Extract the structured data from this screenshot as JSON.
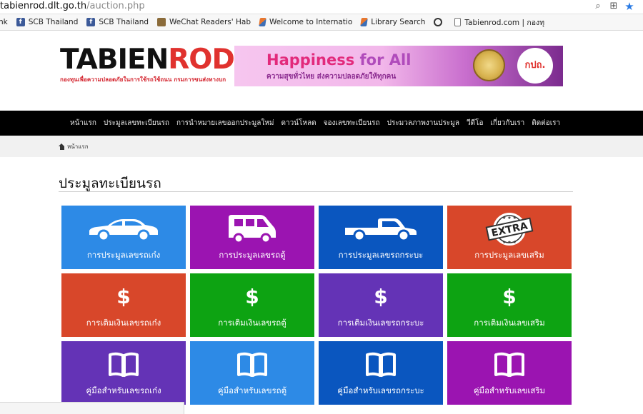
{
  "browser": {
    "url_host": "tabienrod.dlt.go.th",
    "url_path": "/auction.php",
    "bookmarks": [
      {
        "label": "nk",
        "icon": "none"
      },
      {
        "label": "SCB Thailand",
        "icon": "facebook-icon"
      },
      {
        "label": "SCB Thailand",
        "icon": "facebook-icon"
      },
      {
        "label": "WeChat Readers' Hab",
        "icon": "wechat-icon"
      },
      {
        "label": "Welcome to Internatio",
        "icon": "diamond-icon"
      },
      {
        "label": "Library Search",
        "icon": "diamond-icon"
      },
      {
        "label": "",
        "icon": "q-icon"
      },
      {
        "label": "Tabienrod.com | กองทุ",
        "icon": "page-icon"
      }
    ]
  },
  "header": {
    "logo_text_main": "TABIEN",
    "logo_text_accent": "ROD",
    "logo_subtitle": "กองทุนเพื่อความปลอดภัยในการใช้รถใช้ถนน กรมการขนส่งทางบก",
    "banner_title_a": "Happiness ",
    "banner_title_b": "for All",
    "banner_subtitle": "ความสุขทั่วไทย ส่งความปลอดภัยให้ทุกคน",
    "banner_badge": "กปถ."
  },
  "nav": {
    "items": [
      "หน้าแรก",
      "ประมูลเลขทะเบียนรถ",
      "การนำหมายเลขออกประมูลใหม่",
      "ดาวน์โหลด",
      "จองเลขทะเบียนรถ",
      "ประมวลภาพงานประมูล",
      "วีดีโอ",
      "เกี่ยวกับเรา",
      "ติดต่อเรา"
    ]
  },
  "breadcrumb": {
    "home": "หน้าแรก"
  },
  "page": {
    "title": "ประมูลทะเบียนรถ"
  },
  "tiles": [
    {
      "label": "การประมูลเลขรถเก๋ง",
      "icon": "car-icon",
      "color": "#2d8ae6"
    },
    {
      "label": "การประมูลเลขรถตู้",
      "icon": "van-icon",
      "color": "#9b14b1"
    },
    {
      "label": "การประมูลเลขรถกระบะ",
      "icon": "pickup-truck-icon",
      "color": "#0a56bf"
    },
    {
      "label": "การประมูลเลขเสริม",
      "icon": "extra-badge-icon",
      "color": "#d8472a"
    },
    {
      "label": "การเติมเงินเลขรถเก๋ง",
      "icon": "dollar-icon",
      "color": "#d8472a"
    },
    {
      "label": "การเติมเงินเลขรถตู้",
      "icon": "dollar-icon",
      "color": "#0da312"
    },
    {
      "label": "การเติมเงินเลขรถกระบะ",
      "icon": "dollar-icon",
      "color": "#6433b6"
    },
    {
      "label": "การเติมเงินเลขเสริม",
      "icon": "dollar-icon",
      "color": "#0da312"
    },
    {
      "label": "คู่มือสำหรับเลขรถเก๋ง",
      "icon": "book-icon",
      "color": "#6433b6"
    },
    {
      "label": "คู่มือสำหรับเลขรถตู้",
      "icon": "book-icon",
      "color": "#2d8ae6"
    },
    {
      "label": "คู่มือสำหรับเลขรถกระบะ",
      "icon": "book-icon",
      "color": "#0a56bf"
    },
    {
      "label": "คู่มือสำหรับเลขเสริม",
      "icon": "book-icon",
      "color": "#9b14b1"
    }
  ]
}
